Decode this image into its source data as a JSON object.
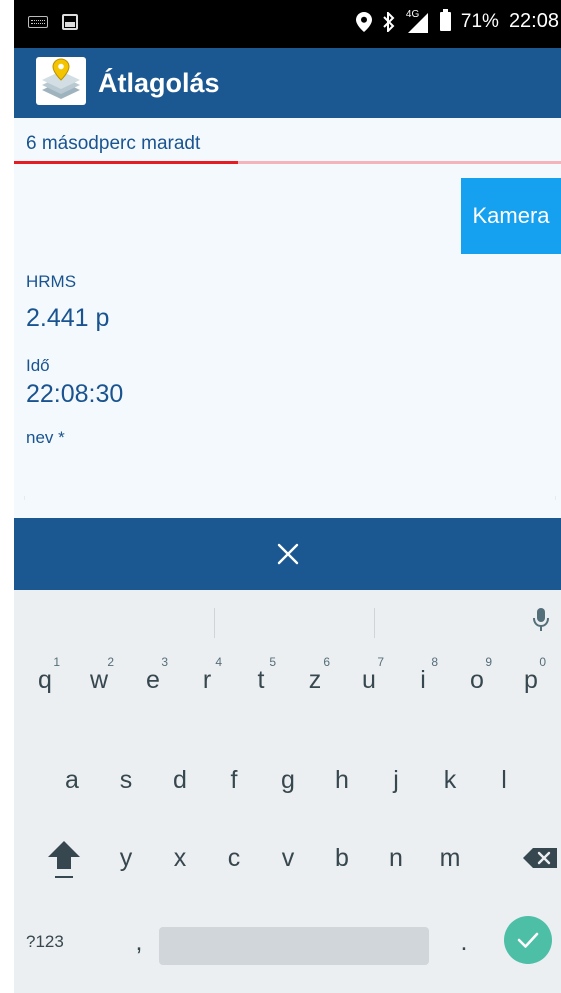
{
  "status_bar": {
    "signal": "4G",
    "battery": "71%",
    "time": "22:08",
    "icons": [
      "keyboard-icon",
      "image-icon",
      "location-icon",
      "bluetooth-icon",
      "signal-icon",
      "battery-icon"
    ]
  },
  "toolbar": {
    "title": "Átlagolás",
    "icon": "app-logo-icon",
    "color": "#1b5891"
  },
  "countdown": {
    "text": "6 másodperc maradt",
    "progress": 0.41,
    "accent": "#e51c24"
  },
  "form": {
    "camera_label": "Kamera",
    "hrms_label": "HRMS",
    "hrms_value": "2.441 p",
    "time_label": "Idő",
    "time_value": "22:08:30",
    "name_label": "nev *",
    "name_value": ""
  },
  "action_bar": {
    "close_icon": "close-icon"
  },
  "keyboard": {
    "row1": [
      {
        "key": "q",
        "hint": "1"
      },
      {
        "key": "w",
        "hint": "2"
      },
      {
        "key": "e",
        "hint": "3"
      },
      {
        "key": "r",
        "hint": "4"
      },
      {
        "key": "t",
        "hint": "5"
      },
      {
        "key": "z",
        "hint": "6"
      },
      {
        "key": "u",
        "hint": "7"
      },
      {
        "key": "i",
        "hint": "8"
      },
      {
        "key": "o",
        "hint": "9"
      },
      {
        "key": "p",
        "hint": "0"
      }
    ],
    "row2": [
      "a",
      "s",
      "d",
      "f",
      "g",
      "h",
      "j",
      "k",
      "l"
    ],
    "row3": [
      "y",
      "x",
      "c",
      "v",
      "b",
      "n",
      "m"
    ],
    "symbols_label": "?123",
    "comma": ",",
    "period": ".",
    "enter_color": "#4cbfa6"
  }
}
